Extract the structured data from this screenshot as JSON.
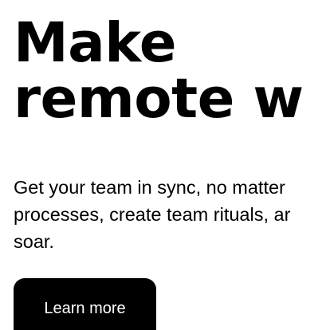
{
  "hero": {
    "title_lines": [
      "Make",
      "remote w"
    ],
    "subtitle_lines": [
      "Get your team in sync, no matter",
      "processes, create team rituals, ar",
      "soar."
    ],
    "cta_label": "Learn more"
  },
  "colors": {
    "background": "#ffffff",
    "text": "#000000",
    "button_bg": "#000000",
    "button_text": "#ffffff"
  }
}
